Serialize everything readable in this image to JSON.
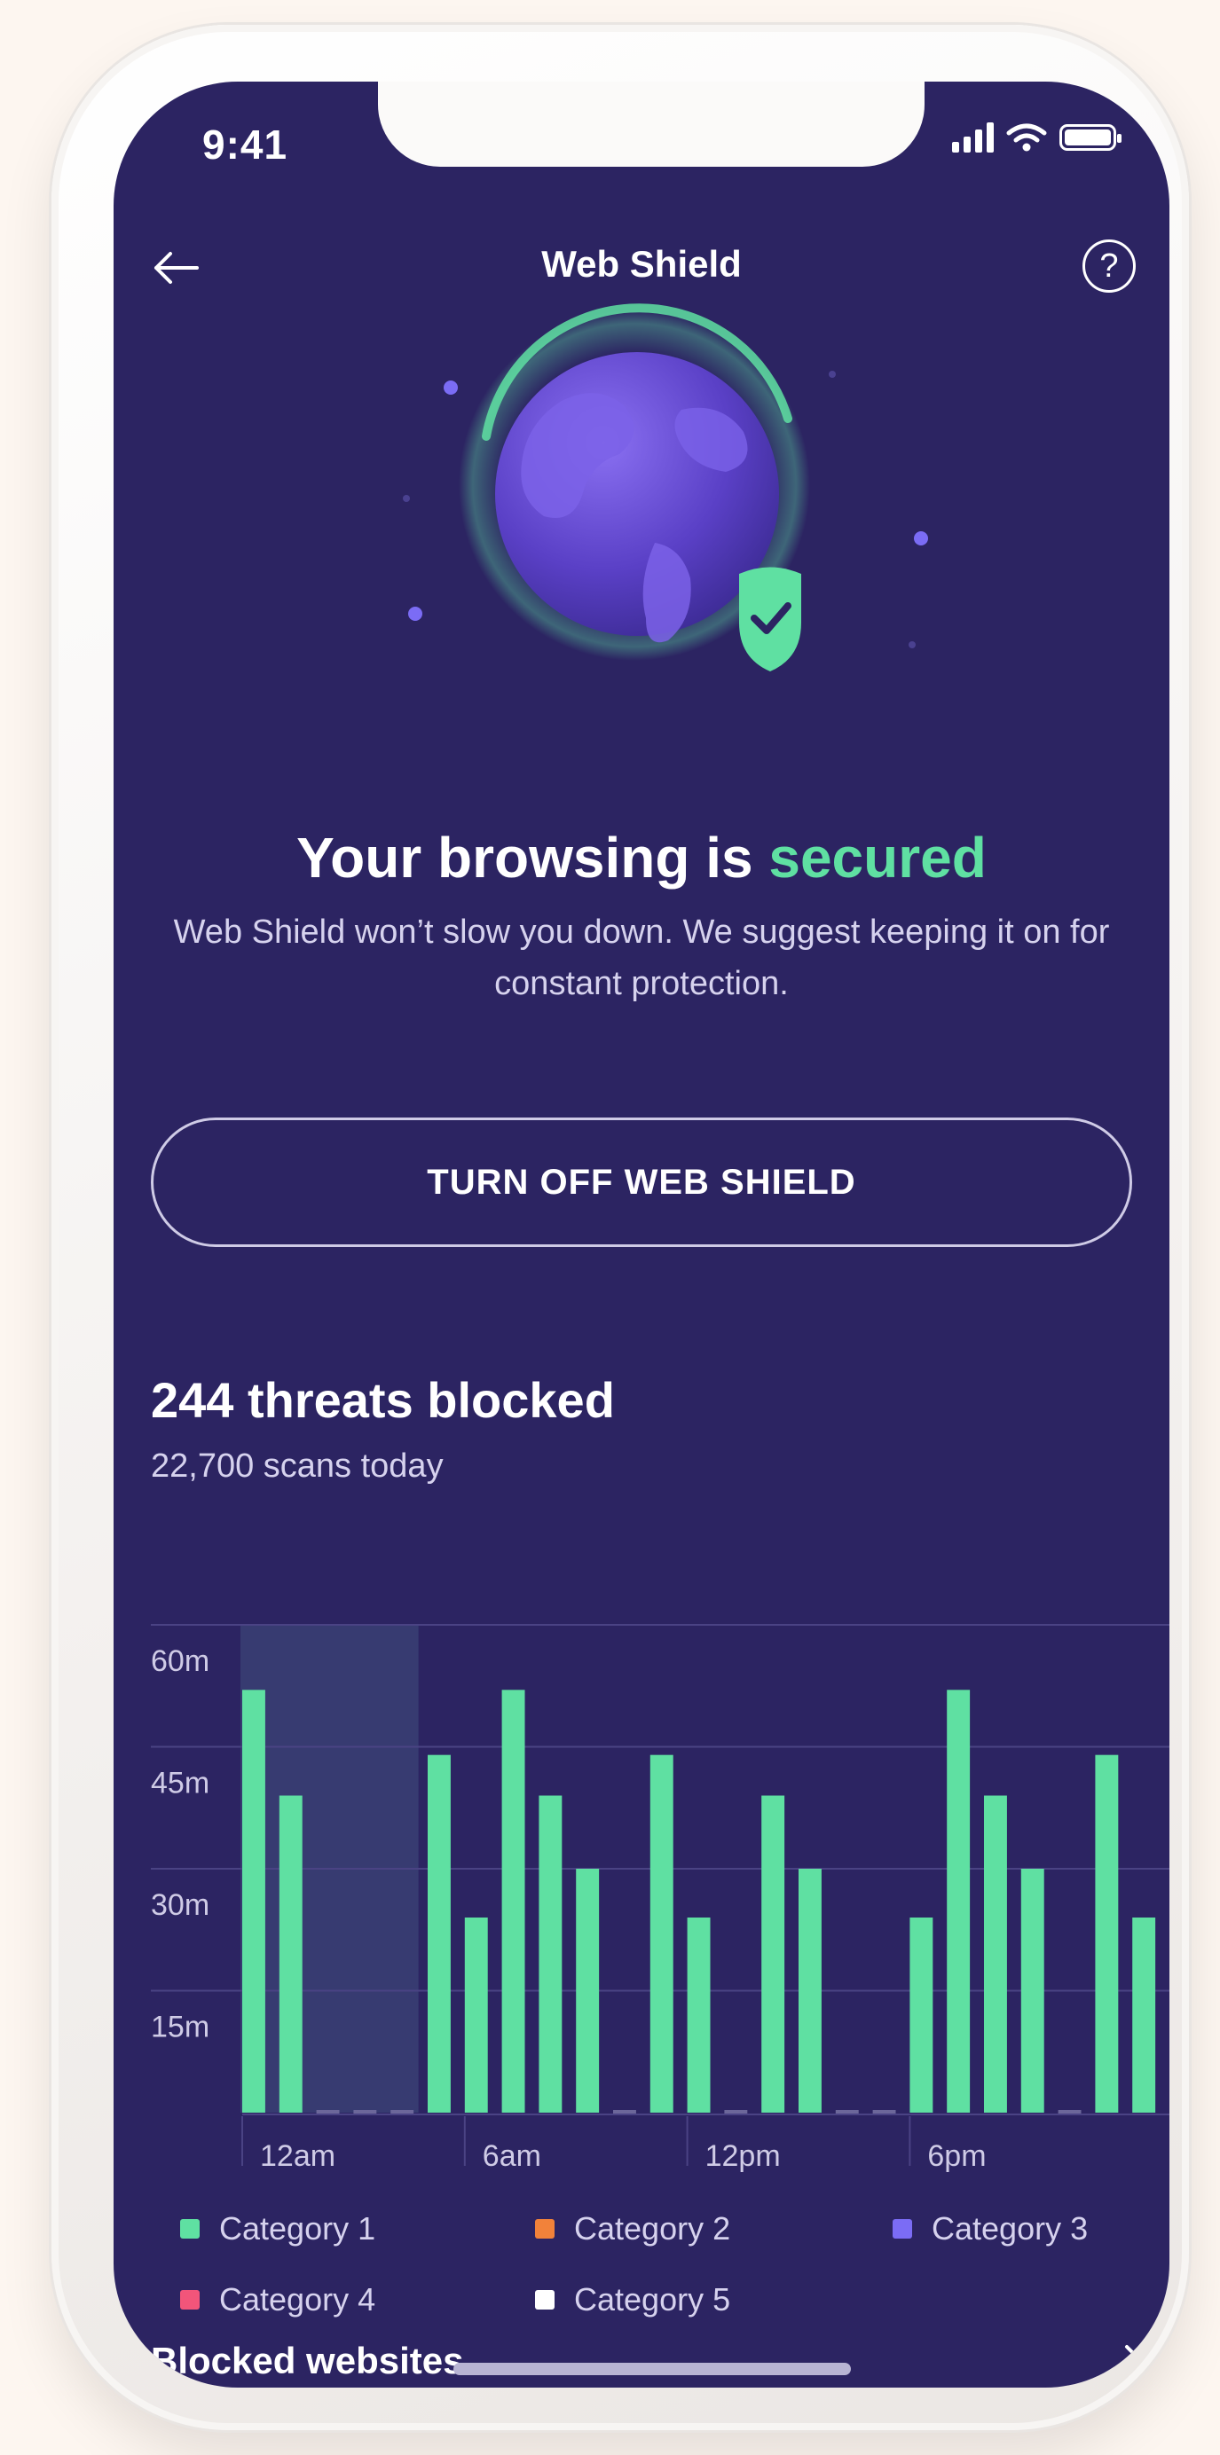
{
  "status_bar": {
    "time": "9:41"
  },
  "header": {
    "title": "Web Shield",
    "help_label": "?"
  },
  "hero": {
    "headline_prefix": "Your browsing is ",
    "headline_accent": "secured",
    "description": "Web Shield won’t slow you down. We suggest keeping it on for constant protection."
  },
  "actions": {
    "turn_off_label": "TURN OFF WEB SHIELD"
  },
  "stats": {
    "threats_blocked": "244 threats blocked",
    "scans_today": "22,700 scans today"
  },
  "colors": {
    "background": "#2c2462",
    "accent_green": "#5fe0a2",
    "category_1": "#5fe0a2",
    "category_2": "#f2823a",
    "category_3": "#7b6cf5",
    "category_4": "#f2557a",
    "category_5": "#ffffff"
  },
  "chart_data": {
    "type": "bar",
    "y_ticks": [
      "60m",
      "45m",
      "30m",
      "15m"
    ],
    "x_ticks": [
      "12am",
      "6am",
      "12pm",
      "6pm"
    ],
    "ylim": [
      0,
      60
    ],
    "series": [
      {
        "name": "Category 1",
        "values": [
          52,
          39,
          0,
          0,
          0,
          44,
          24,
          52,
          39,
          30,
          0,
          44,
          24,
          0,
          39,
          30,
          0,
          0,
          24,
          52,
          39,
          30,
          0,
          44,
          24
        ]
      }
    ],
    "highlight_range": [
      0,
      5
    ],
    "grid": true
  },
  "legend": [
    {
      "label": "Category 1",
      "color": "#5fe0a2"
    },
    {
      "label": "Category 2",
      "color": "#f2823a"
    },
    {
      "label": "Category 3",
      "color": "#7b6cf5"
    },
    {
      "label": "Category 4",
      "color": "#f2557a"
    },
    {
      "label": "Category 5",
      "color": "#ffffff"
    }
  ],
  "blocked_websites": {
    "label": "Blocked websites"
  },
  "icons": {
    "back": "arrow-left-icon",
    "help": "question-circle-icon",
    "globe": "globe-icon",
    "shield": "shield-check-icon",
    "chevron": "chevron-right-icon"
  }
}
